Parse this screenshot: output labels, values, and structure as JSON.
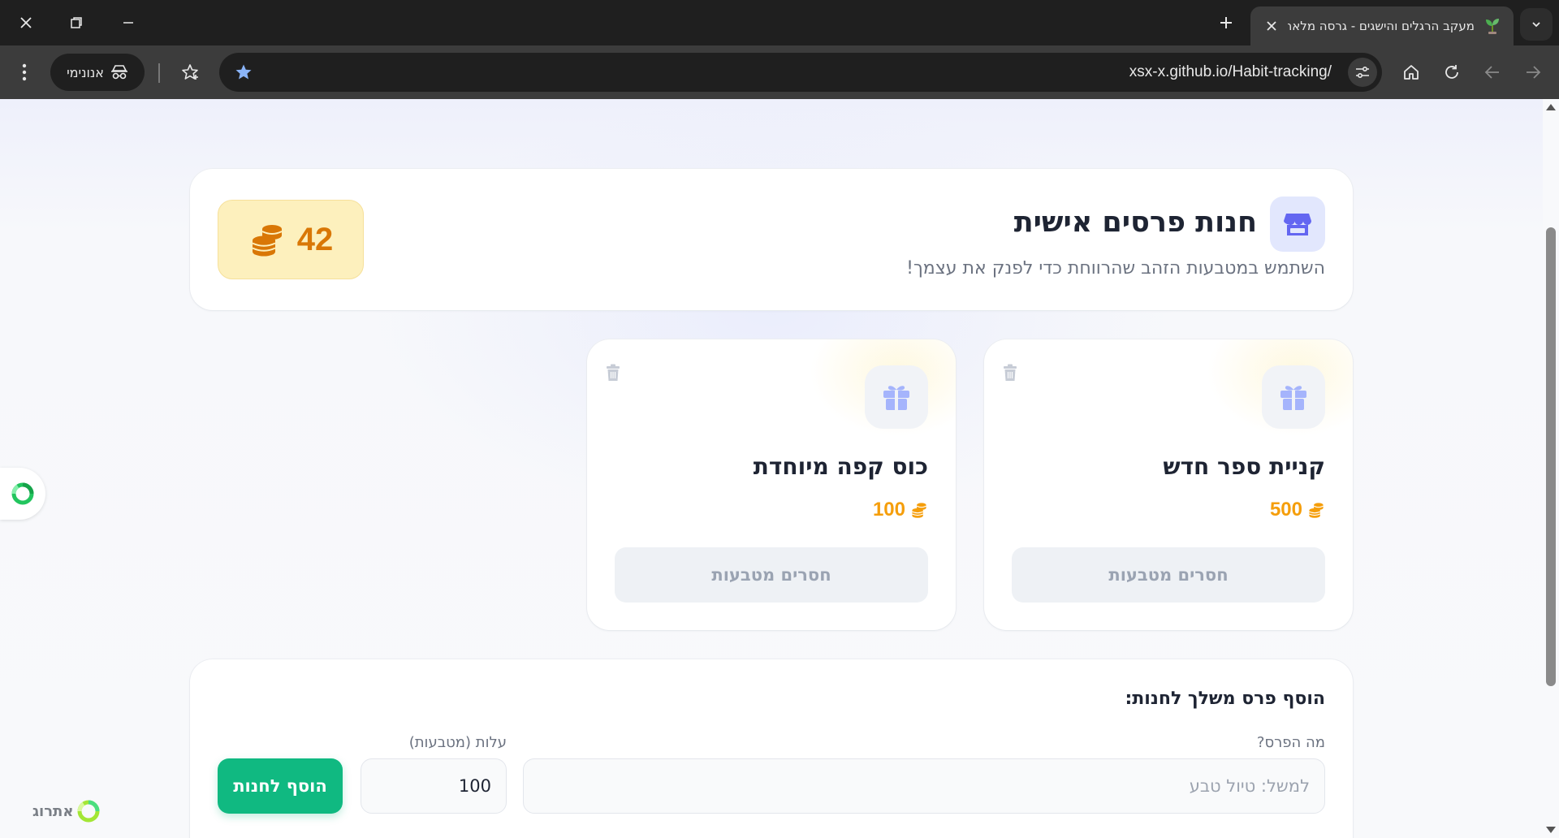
{
  "browser": {
    "tab_title": "מעקב הרגלים והישגים - גרסה מלאה",
    "url": "xsx-x.github.io/Habit-tracking/",
    "incognito_label": "אנונימי"
  },
  "store": {
    "title": "חנות פרסים אישית",
    "subtitle": "השתמש במטבעות הזהב שהרווחת כדי לפנק את עצמך!",
    "coins": "42"
  },
  "rewards": [
    {
      "name": "קניית ספר חדש",
      "cost": "500",
      "button_label": "חסרים מטבעות"
    },
    {
      "name": "כוס קפה מיוחדת",
      "cost": "100",
      "button_label": "חסרים מטבעות"
    }
  ],
  "add_form": {
    "title": "הוסף פרס משלך לחנות:",
    "name_label": "מה הפרס?",
    "name_placeholder": "למשל: טיול טבע",
    "cost_label": "עלות (מטבעות)",
    "cost_value": "100",
    "submit_label": "הוסף לחנות"
  },
  "brand": {
    "name": "אתרוג"
  },
  "colors": {
    "accent": "#10b981",
    "coin": "#f59e0b",
    "coin_dark": "#d97706",
    "store_icon": "#6366f1",
    "gift_icon": "#a5b4fc"
  },
  "icons": [
    "close-icon",
    "restore-icon",
    "minimize-icon",
    "new-tab-icon",
    "tab-close-icon",
    "tab-list-icon",
    "menu-icon",
    "incognito-icon",
    "bookmark-star-icon",
    "bookmark-filled-star-icon",
    "site-info-icon",
    "home-icon",
    "reload-icon",
    "back-icon",
    "forward-icon",
    "store-icon",
    "coins-icon",
    "gift-icon",
    "trash-icon"
  ]
}
